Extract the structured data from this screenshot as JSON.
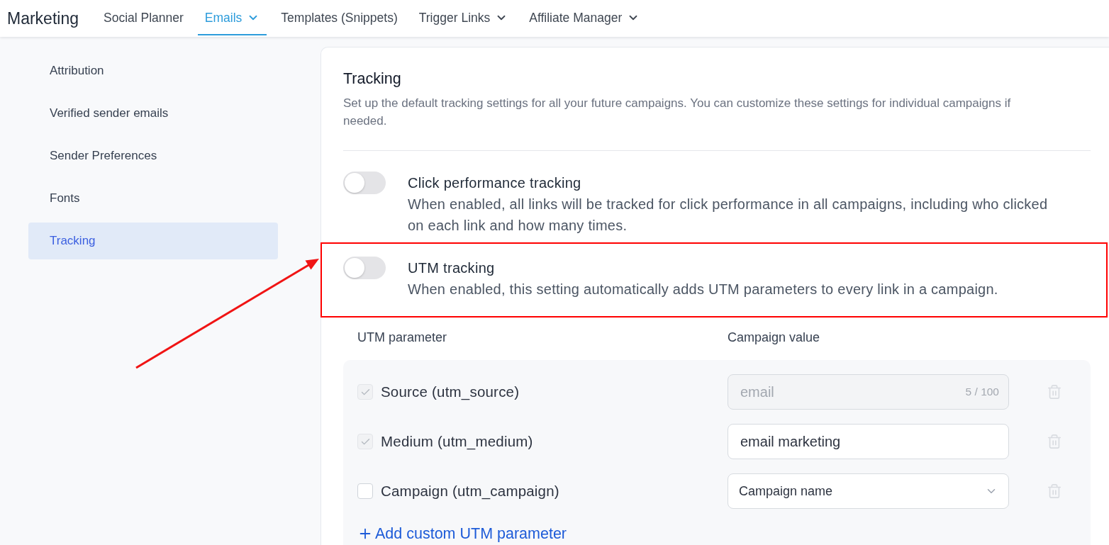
{
  "header": {
    "title": "Marketing",
    "tabs": [
      {
        "label": "Social Planner",
        "selected": false,
        "dropdown": false
      },
      {
        "label": "Emails",
        "selected": true,
        "dropdown": true
      },
      {
        "label": "Templates (Snippets)",
        "selected": false,
        "dropdown": false
      },
      {
        "label": "Trigger Links",
        "selected": false,
        "dropdown": true
      },
      {
        "label": "Affiliate Manager",
        "selected": false,
        "dropdown": true
      }
    ]
  },
  "sidebar": {
    "items": [
      {
        "label": "Attribution",
        "selected": false
      },
      {
        "label": "Verified sender emails",
        "selected": false
      },
      {
        "label": "Sender Preferences",
        "selected": false
      },
      {
        "label": "Fonts",
        "selected": false
      },
      {
        "label": "Tracking",
        "selected": true
      }
    ]
  },
  "panel": {
    "title": "Tracking",
    "description": "Set up the default tracking settings for all your future campaigns. You can customize these settings for individual campaigns if needed.",
    "settings": [
      {
        "title": "Click performance tracking",
        "description": "When enabled, all links will be tracked for click performance in all campaigns, including who clicked on each link and how many times.",
        "on": false,
        "highlighted": false
      },
      {
        "title": "UTM tracking",
        "description": "When enabled, this setting automatically adds UTM parameters to every link in a campaign.",
        "on": false,
        "highlighted": true
      }
    ],
    "utm_table": {
      "columns": [
        "UTM parameter",
        "Campaign value"
      ],
      "rows": [
        {
          "label": "Source (utm_source)",
          "checked": true,
          "disabled": true,
          "field": {
            "kind": "text",
            "value": "email",
            "counter": "5 / 100",
            "disabled": true
          }
        },
        {
          "label": "Medium (utm_medium)",
          "checked": true,
          "disabled": true,
          "field": {
            "kind": "text",
            "value": "email marketing",
            "disabled": false
          }
        },
        {
          "label": "Campaign (utm_campaign)",
          "checked": false,
          "disabled": false,
          "field": {
            "kind": "select",
            "value": "Campaign name"
          }
        }
      ],
      "add_link": "Add custom UTM parameter"
    }
  }
}
